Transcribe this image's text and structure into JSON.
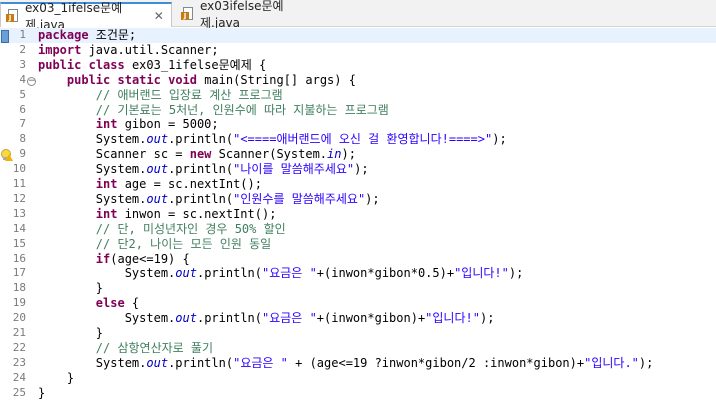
{
  "tabs": [
    {
      "label": "ex03_1ifelse문예제.java",
      "active": true,
      "icon": "java-file-icon",
      "closable": true
    },
    {
      "label": "ex03ifelse문예제.java",
      "active": false,
      "icon": "java-file-icon",
      "closable": false
    }
  ],
  "tab_close_glyph": "✕",
  "current_line": 1,
  "lines": [
    {
      "n": "1",
      "segs": [
        [
          "kw",
          "package"
        ],
        [
          "vr",
          " 조건문;"
        ]
      ]
    },
    {
      "n": "2",
      "segs": [
        [
          "kw",
          "import"
        ],
        [
          "vr",
          " java.util.Scanner;"
        ]
      ]
    },
    {
      "n": "3",
      "segs": [
        [
          "kw",
          "public"
        ],
        [
          "vr",
          " "
        ],
        [
          "kw",
          "class"
        ],
        [
          "vr",
          " ex03_1ifelse문예제 {"
        ]
      ]
    },
    {
      "n": "4",
      "fold": "⊖",
      "segs": [
        [
          "vr",
          "    "
        ],
        [
          "kw",
          "public"
        ],
        [
          "vr",
          " "
        ],
        [
          "kw",
          "static"
        ],
        [
          "vr",
          " "
        ],
        [
          "kw",
          "void"
        ],
        [
          "vr",
          " main(String[] args) {"
        ]
      ]
    },
    {
      "n": "5",
      "segs": [
        [
          "vr",
          "        "
        ],
        [
          "cm",
          "// 애버랜드 입장료 계산 프로그램"
        ]
      ]
    },
    {
      "n": "6",
      "segs": [
        [
          "vr",
          "        "
        ],
        [
          "cm",
          "// 기본료는 5처넌, 인원수에 따라 지불하는 프로그램"
        ]
      ]
    },
    {
      "n": "7",
      "segs": [
        [
          "vr",
          "        "
        ],
        [
          "kw",
          "int"
        ],
        [
          "vr",
          " gibon = 5000;"
        ]
      ]
    },
    {
      "n": "8",
      "segs": [
        [
          "vr",
          "        System."
        ],
        [
          "fld",
          "out"
        ],
        [
          "vr",
          ".println("
        ],
        [
          "st",
          "\"<====애버랜드에 오신 걸 환영합니다!====>\""
        ],
        [
          "vr",
          ");"
        ]
      ]
    },
    {
      "n": "9",
      "warning": true,
      "segs": [
        [
          "vr",
          "        Scanner "
        ],
        [
          "vr",
          "sc"
        ],
        [
          "vr",
          " = "
        ],
        [
          "kw",
          "new"
        ],
        [
          "vr",
          " Scanner(System."
        ],
        [
          "fld",
          "in"
        ],
        [
          "vr",
          ");"
        ]
      ]
    },
    {
      "n": "10",
      "segs": [
        [
          "vr",
          "        System."
        ],
        [
          "fld",
          "out"
        ],
        [
          "vr",
          ".println("
        ],
        [
          "st",
          "\"나이를 말씀해주세요\""
        ],
        [
          "vr",
          ");"
        ]
      ]
    },
    {
      "n": "11",
      "segs": [
        [
          "vr",
          "        "
        ],
        [
          "kw",
          "int"
        ],
        [
          "vr",
          " age = sc.nextInt();"
        ]
      ]
    },
    {
      "n": "12",
      "segs": [
        [
          "vr",
          "        System."
        ],
        [
          "fld",
          "out"
        ],
        [
          "vr",
          ".println("
        ],
        [
          "st",
          "\"인원수를 말씀해주세요\""
        ],
        [
          "vr",
          ");"
        ]
      ]
    },
    {
      "n": "13",
      "segs": [
        [
          "vr",
          "        "
        ],
        [
          "kw",
          "int"
        ],
        [
          "vr",
          " inwon = sc.nextInt();"
        ]
      ]
    },
    {
      "n": "14",
      "segs": [
        [
          "vr",
          "        "
        ],
        [
          "cm",
          "// 단, 미성년자인 경우 50% 할인"
        ]
      ]
    },
    {
      "n": "15",
      "segs": [
        [
          "vr",
          "        "
        ],
        [
          "cm",
          "// 단2, 나이는 모든 인원 동일"
        ]
      ]
    },
    {
      "n": "16",
      "segs": [
        [
          "vr",
          "        "
        ],
        [
          "kw",
          "if"
        ],
        [
          "vr",
          "(age<=19) {"
        ]
      ]
    },
    {
      "n": "17",
      "segs": [
        [
          "vr",
          "            System."
        ],
        [
          "fld",
          "out"
        ],
        [
          "vr",
          ".println("
        ],
        [
          "st",
          "\"요금은 \""
        ],
        [
          "vr",
          "+(inwon*gibon*0.5)+"
        ],
        [
          "st",
          "\"입니다!\""
        ],
        [
          "vr",
          ");"
        ]
      ]
    },
    {
      "n": "18",
      "segs": [
        [
          "vr",
          "        }"
        ]
      ]
    },
    {
      "n": "19",
      "segs": [
        [
          "vr",
          "        "
        ],
        [
          "kw",
          "else"
        ],
        [
          "vr",
          " {"
        ]
      ]
    },
    {
      "n": "20",
      "segs": [
        [
          "vr",
          "            System."
        ],
        [
          "fld",
          "out"
        ],
        [
          "vr",
          ".println("
        ],
        [
          "st",
          "\"요금은 \""
        ],
        [
          "vr",
          "+(inwon*gibon)+"
        ],
        [
          "st",
          "\"입니다!\""
        ],
        [
          "vr",
          ");"
        ]
      ]
    },
    {
      "n": "21",
      "segs": [
        [
          "vr",
          "        }"
        ]
      ]
    },
    {
      "n": "22",
      "segs": [
        [
          "vr",
          "        "
        ],
        [
          "cm",
          "// 삼항연산자로 풀기"
        ]
      ]
    },
    {
      "n": "23",
      "segs": [
        [
          "vr",
          "        System."
        ],
        [
          "fld",
          "out"
        ],
        [
          "vr",
          ".println("
        ],
        [
          "st",
          "\"요금은 \""
        ],
        [
          "vr",
          " + (age<=19 ?inwon*gibon/2 :inwon*gibon)+"
        ],
        [
          "st",
          "\"입니다.\""
        ],
        [
          "vr",
          ");"
        ]
      ]
    },
    {
      "n": "24",
      "segs": [
        [
          "vr",
          "    }"
        ]
      ]
    },
    {
      "n": "25",
      "segs": [
        [
          "vr",
          "}"
        ]
      ]
    }
  ],
  "colors": {
    "keyword": "#7f0055",
    "comment": "#3f7f5f",
    "string": "#2a00ff",
    "static_field": "#0000c0",
    "current_line": "#e8f2fe",
    "active_tab_accent": "#3f8cd9"
  }
}
